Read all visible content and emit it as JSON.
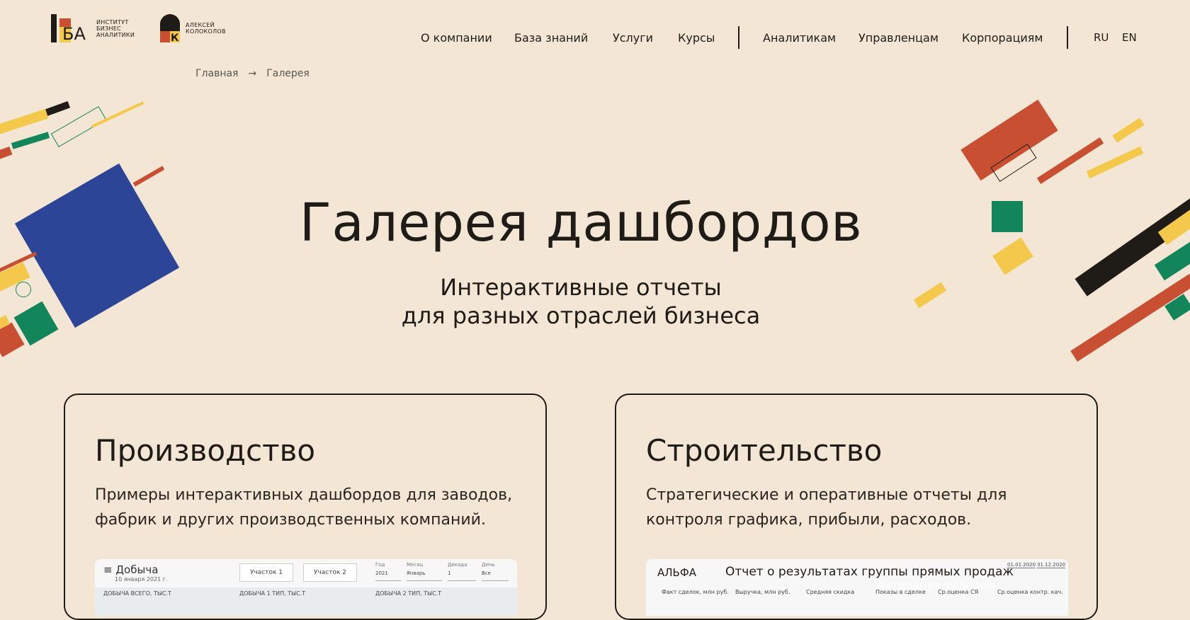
{
  "header": {
    "logo_iba": {
      "mark": "ИБА",
      "lines": [
        "ИНСТИТУТ",
        "БИЗНЕС",
        "АНАЛИТИКИ"
      ]
    },
    "logo_ak": {
      "mark": "АК",
      "lines": [
        "АЛЕКСЕЙ",
        "КОЛОКОЛОВ"
      ]
    },
    "nav": [
      "О компании",
      "База знаний",
      "Услуги",
      "Курсы",
      "Аналитикам",
      "Управленцам",
      "Корпорациям"
    ],
    "lang": [
      "RU",
      "EN"
    ]
  },
  "breadcrumb": {
    "home": "Главная",
    "arrow": "→",
    "current": "Галерея"
  },
  "hero": {
    "title": "Галерея дашбордов",
    "subtitle_1": "Интерактивные отчеты",
    "subtitle_2": "для разных отраслей бизнеса"
  },
  "cards": [
    {
      "title": "Производство",
      "desc": "Примеры интерактивных дашбордов для заводов, фабрик и других производственных компаний.",
      "preview": {
        "menu": "≡ Добыча",
        "date": "10 января 2021 г.",
        "btn1": "Участок 1",
        "btn2": "Участок 2",
        "filters": [
          {
            "label": "Год",
            "value": "2021"
          },
          {
            "label": "Месяц",
            "value": "Январь"
          },
          {
            "label": "Декада",
            "value": "1"
          },
          {
            "label": "День",
            "value": "Все"
          }
        ],
        "kpis": [
          "ДОБЫЧА ВСЕГО, ТЫС.Т",
          "ДОБЫЧА 1 ТИП, ТЫС.Т",
          "ДОБЫЧА 2 ТИП, ТЫС.Т"
        ]
      }
    },
    {
      "title": "Строительство",
      "desc": "Стратегические и оперативные отчеты для контроля графика, прибыли, расходов.",
      "preview": {
        "brand": "АЛЬФА",
        "title": "Отчет о результатах группы прямых продаж",
        "date_from": "01.01.2020",
        "date_to": "31.12.2020",
        "cols": [
          "Факт сделок, млн руб.",
          "Выручка, млн руб.",
          "Средняя скидка",
          "Показы в сделке",
          "Ср.оценка СЯ",
          "Ср.оценка контр. кач."
        ]
      }
    }
  ],
  "colors": {
    "background": "#f3e6d4",
    "blue": "#2c4596",
    "red": "#c94f33",
    "yellow": "#f4c84b",
    "green": "#12865a",
    "dark": "#1f1b17"
  },
  "watermark": "Активация Windows"
}
